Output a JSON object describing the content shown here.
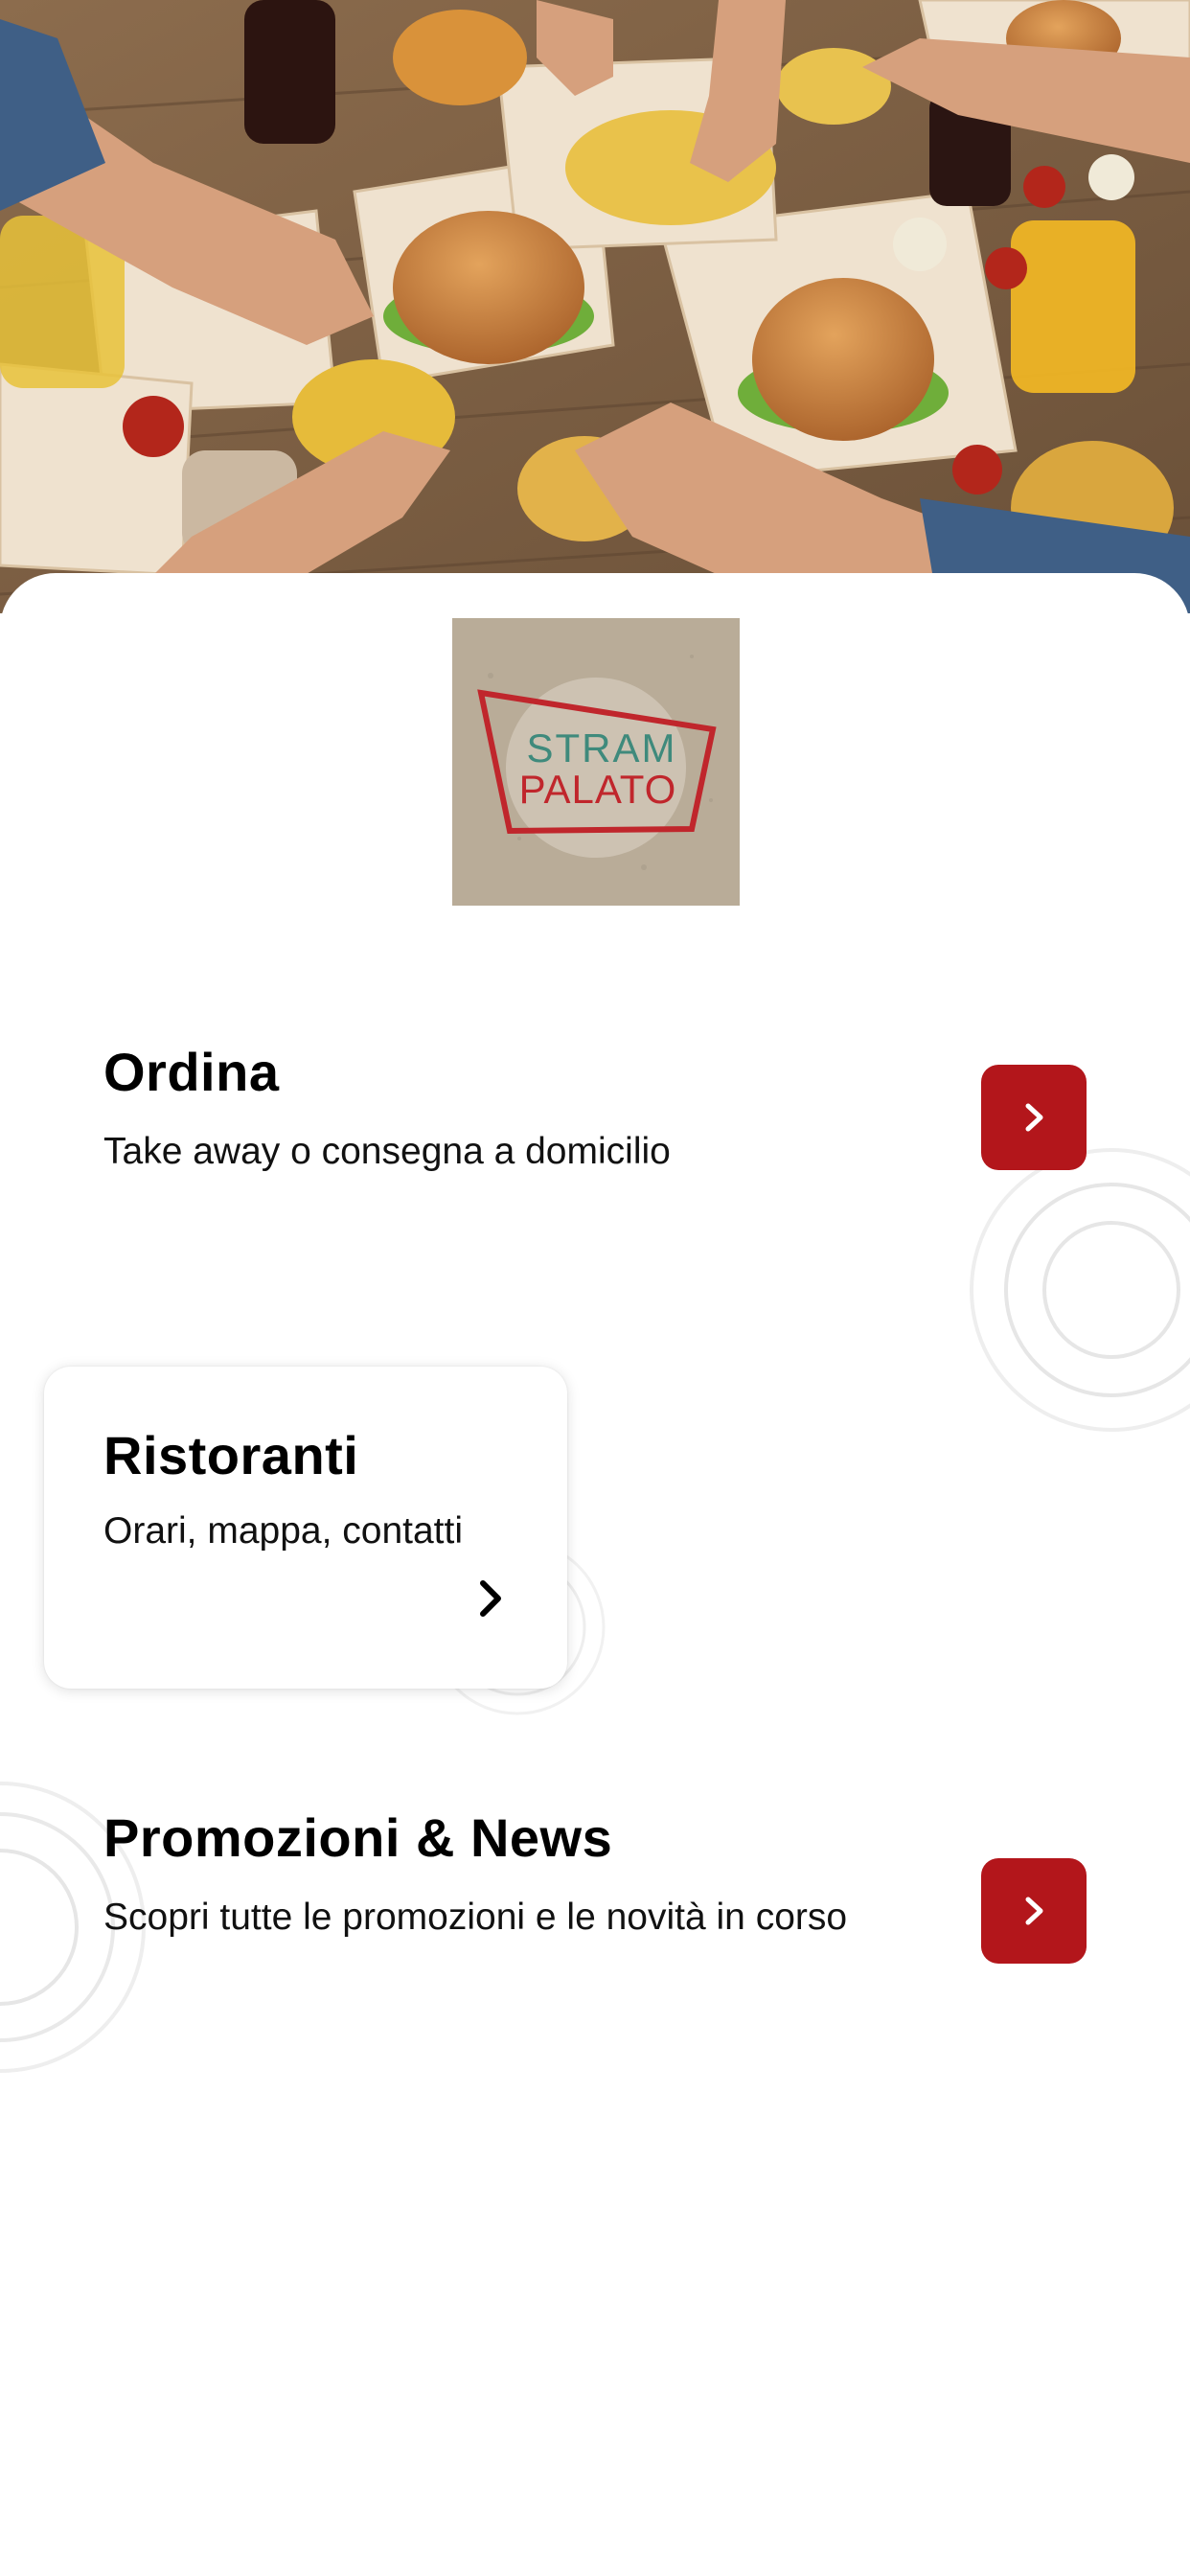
{
  "hero": {
    "image": "food-table-photo"
  },
  "brand": {
    "logo_line1": "STRAM",
    "logo_line2": "PALATO"
  },
  "menu": {
    "order": {
      "title": "Ordina",
      "subtitle": "Take away o consegna a domicilio",
      "icon": "chevron-right-icon"
    },
    "restaurants": {
      "title": "Ristoranti",
      "subtitle": "Orari, mappa, contatti",
      "icon": "chevron-right-icon"
    },
    "promotions": {
      "title": "Promozioni & News",
      "subtitle": "Scopri tutte le promozioni e le novità in corso",
      "icon": "chevron-right-icon"
    }
  },
  "colors": {
    "accent": "#b3161b",
    "logo_teal": "#3f8a7c",
    "logo_red": "#c0262c",
    "background": "#ffffff"
  }
}
